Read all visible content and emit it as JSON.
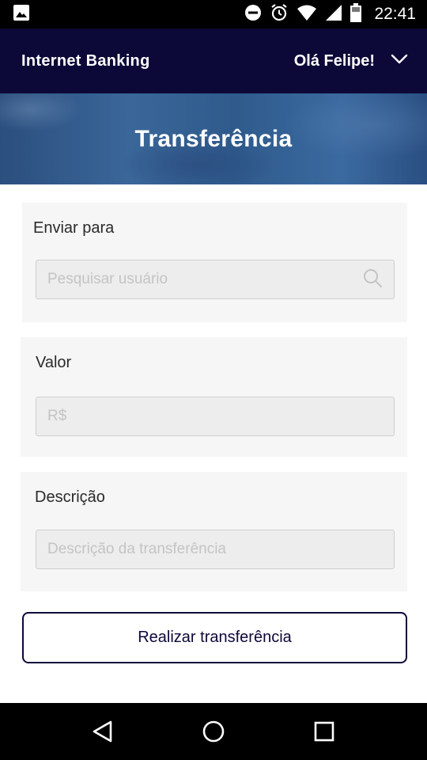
{
  "status_bar": {
    "time": "22:41",
    "icons": [
      "image-icon",
      "do-not-disturb-icon",
      "alarm-icon",
      "wifi-icon",
      "signal-icon",
      "battery-icon"
    ]
  },
  "header": {
    "brand": "Internet Banking",
    "greeting": "Olá Felipe!",
    "menu_icon": "chevron-down-icon"
  },
  "banner": {
    "title": "Transferência"
  },
  "form": {
    "recipient": {
      "label": "Enviar para",
      "placeholder": "Pesquisar usuário",
      "value": "",
      "icon": "search-icon"
    },
    "amount": {
      "label": "Valor",
      "placeholder": "R$",
      "value": ""
    },
    "description": {
      "label": "Descrição",
      "placeholder": "Descrição da transferência",
      "value": ""
    },
    "submit_label": "Realizar transferência"
  },
  "nav_bar": {
    "buttons": [
      "back-icon",
      "home-icon",
      "recents-icon"
    ]
  },
  "colors": {
    "header_bg": "#0c0838",
    "card_bg": "#f6f6f6",
    "field_bg": "#ededed",
    "accent": "#0c0838"
  }
}
